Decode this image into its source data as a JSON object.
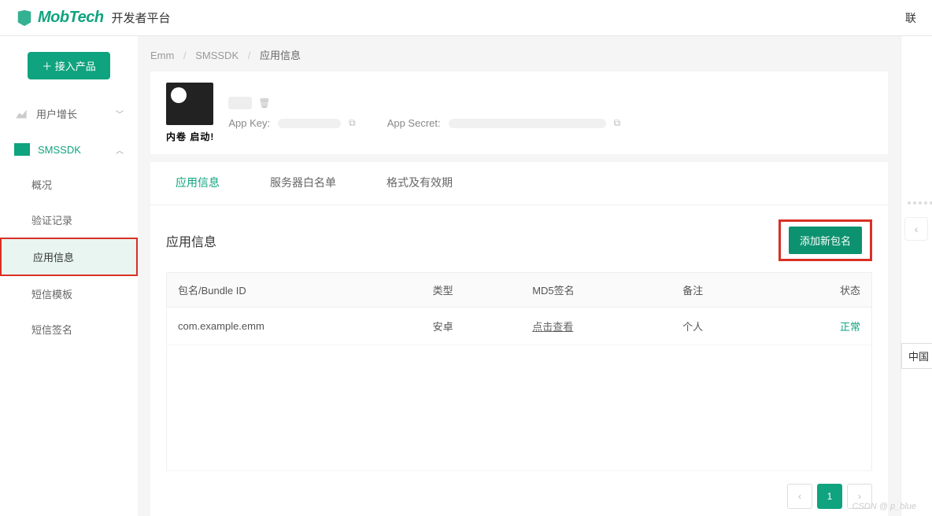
{
  "header": {
    "brand": "MobTech",
    "platform": "开发者平台",
    "right_link": "联"
  },
  "sidebar": {
    "access_btn": "＋ 接入产品",
    "groups": [
      {
        "label": "用户增长",
        "icon": "growth-icon",
        "active": false
      },
      {
        "label": "SMSSDK",
        "icon": "sms-icon",
        "active": true
      }
    ],
    "sub_items": [
      "概况",
      "验证记录",
      "应用信息",
      "短信模板",
      "短信签名"
    ],
    "selected_index": 2
  },
  "breadcrumb": {
    "items": [
      "Emm",
      "SMSSDK",
      "应用信息"
    ]
  },
  "app_card": {
    "avatar_caption": "内卷  启动!",
    "key_label": "App Key:",
    "secret_label": "App Secret:"
  },
  "tabs": {
    "items": [
      "应用信息",
      "服务器白名单",
      "格式及有效期"
    ],
    "active": 0
  },
  "panel": {
    "title": "应用信息",
    "add_btn": "添加新包名",
    "columns": [
      "包名/Bundle ID",
      "类型",
      "MD5签名",
      "备注",
      "状态"
    ],
    "rows": [
      {
        "bundle": "com.example.emm",
        "type": "安卓",
        "md5": "点击查看",
        "remark": "个人",
        "status": "正常"
      }
    ]
  },
  "pager": {
    "current": "1"
  },
  "rail": {
    "country": "中国"
  },
  "watermark": "CSDN @ p_blue"
}
